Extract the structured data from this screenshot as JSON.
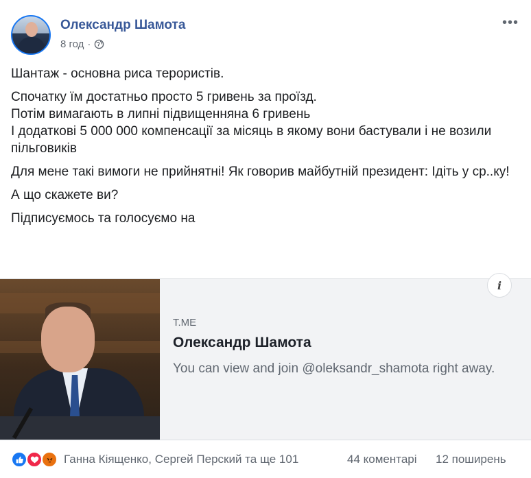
{
  "post": {
    "author": "Олександр Шамота",
    "time": "8 год",
    "separator": "·",
    "more": "•••",
    "paragraphs": [
      "Шантаж - основна риса терористів.",
      "Спочатку їм достатньо просто 5 гривень за проїзд.",
      "Потім вимагають в липні підвищенняна 6 гривень",
      "І додаткові 5 000 000 компенсації за місяць в якому вони бастували і не возили пільговиків",
      "Для мене такі вимоги не прийнятні! Як говорив майбутній президент: Ідіть у ср..ку!",
      "А що скажете ви?",
      "Підписуємось та голосуємо на"
    ]
  },
  "link_preview": {
    "domain": "T.ME",
    "title": "Олександр Шамота",
    "description": "You can view and join @oleksandr_shamota right away.",
    "info": "i"
  },
  "footer": {
    "reaction_icons": [
      "like-icon",
      "love-icon",
      "angry-icon"
    ],
    "reaction_names": "Ганна Кіященко, Сергей Перский та ще 101",
    "comments": "44 коментарі",
    "shares": "12 поширень"
  },
  "colors": {
    "author": "#385898",
    "like": "#1877f2",
    "love": "#f0284a",
    "angry": "#e9710f"
  }
}
